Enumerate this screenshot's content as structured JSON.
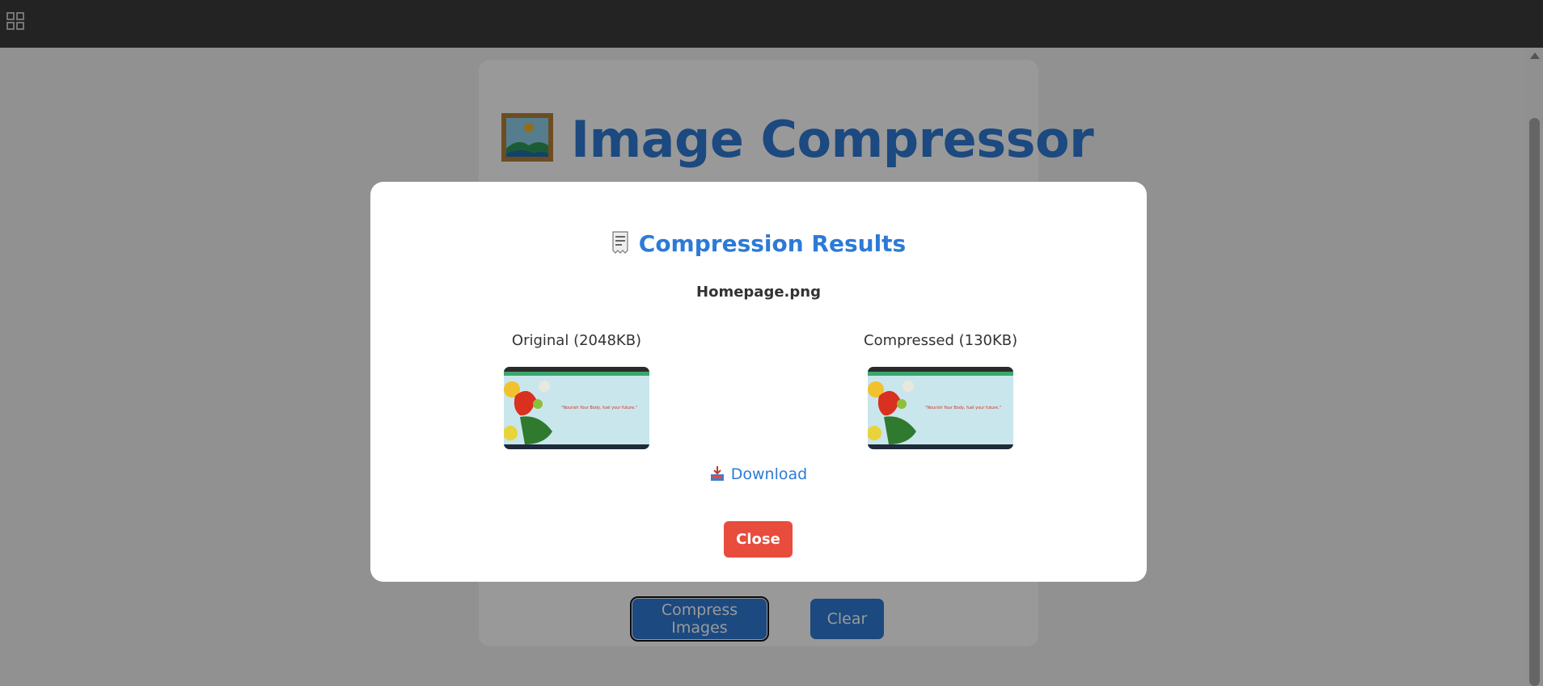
{
  "topbar": {
    "apps_icon": "grid-icon"
  },
  "app": {
    "title": "Image Compressor",
    "title_icon": "framed-picture-icon",
    "compress_button": "Compress Images",
    "clear_button": "Clear"
  },
  "modal": {
    "title": "Compression Results",
    "title_icon": "receipt-icon",
    "file_name": "Homepage.png",
    "original_label": "Original (2048KB)",
    "compressed_label": "Compressed (130KB)",
    "thumbnail_text": "\"Nourish Your Body, fuel your future.\"",
    "download_label": "Download",
    "download_icon": "inbox-tray-icon",
    "close_label": "Close"
  },
  "colors": {
    "accent": "#2d7ad6",
    "close_button": "#e74c3c",
    "topbar": "#3b3b3b"
  }
}
